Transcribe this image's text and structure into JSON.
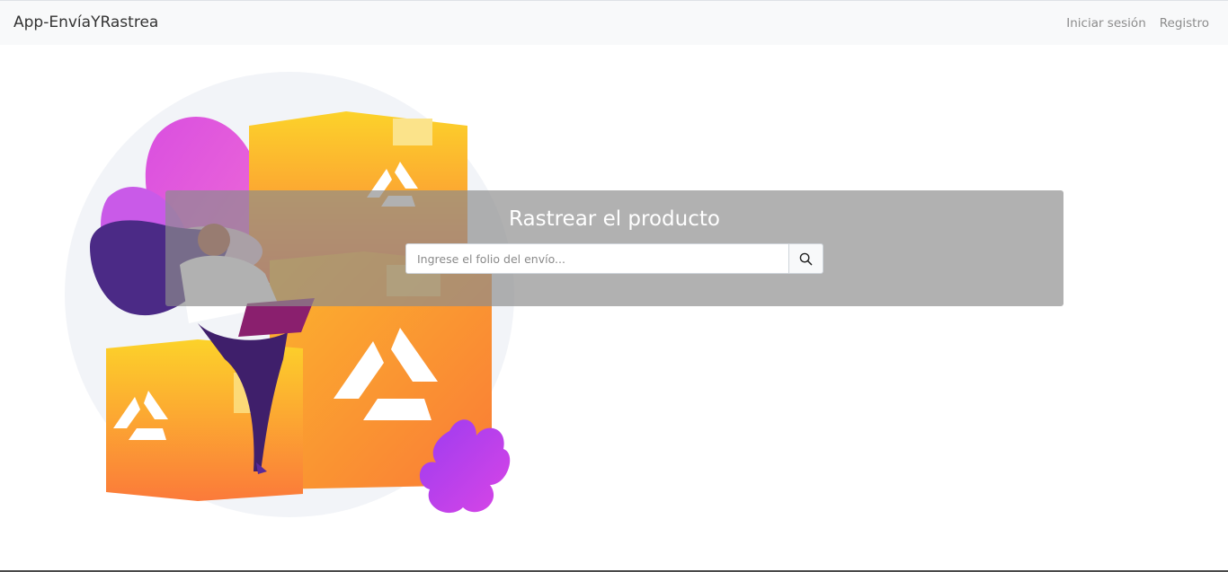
{
  "navbar": {
    "brand": "App-EnvíaYRastrea",
    "links": [
      {
        "label": "Iniciar sesión"
      },
      {
        "label": "Registro"
      }
    ]
  },
  "tracking": {
    "title": "Rastrear el producto",
    "search_placeholder": "Ingrese el folio del envío...",
    "search_value": "",
    "search_button_icon": "search-icon"
  },
  "colors": {
    "navbar_bg": "#f8f9fa",
    "panel_overlay": "#8c8c8c",
    "box_orange": "#fbb03b",
    "accent_pink": "#e94fd8",
    "accent_purple": "#6b2fa6"
  }
}
